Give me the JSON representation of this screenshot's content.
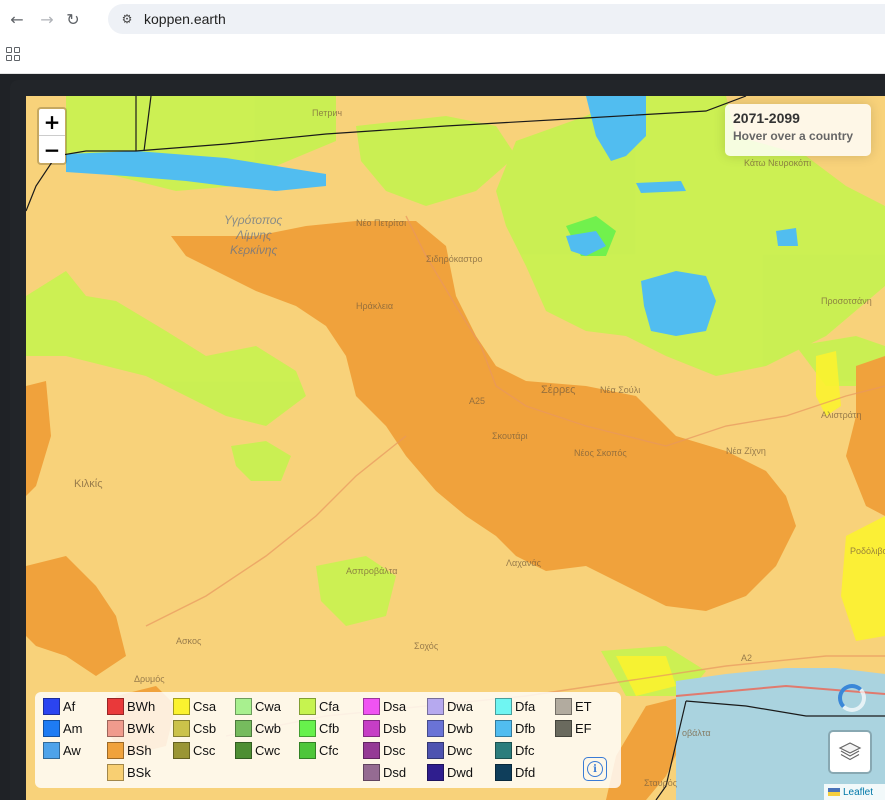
{
  "browser": {
    "url": "koppen.earth",
    "icons": [
      "back-arrow-icon",
      "forward-arrow-icon",
      "reload-icon",
      "site-settings-icon",
      "apps-grid-icon"
    ]
  },
  "map": {
    "zoom_in": "+",
    "zoom_out": "−",
    "info": {
      "period": "2071-2099",
      "hint": "Hover over a country"
    },
    "places": {
      "petrich": "Πетрич",
      "kato_nevrokopi": "Κάτω Νευροκόπι",
      "lake_1": "Υγρότοπος",
      "lake_2": "Λίμνης",
      "lake_3": "Κερκίνης",
      "nea_petritsi": "Νέο Πετρίτσι",
      "sidirokastro": "Σιδηρόκαστρο",
      "irakleia": "Ηράκλεια",
      "serres": "Σέρρες",
      "nea_souli": "Νέα Σούλι",
      "a25": "A25",
      "prosotsani": "Προσοτσάνη",
      "alistrati": "Αλιστράτη",
      "nea_zichni": "Νέα Ζίχνη",
      "skoutari": "Σκουτάρι",
      "neos_skopos": "Νέος Σκοπός",
      "kilkis": "Κιλκίς",
      "rodolivos": "Ροδόλιβος",
      "lachanas": "Λαχανάς",
      "asprovalta_1": "Ασπροβάλτα",
      "asvestochori": "Ασκος",
      "sochos": "Σοχός",
      "drymos": "Δρυμός",
      "a2": "A2",
      "provalta": "οβάλτα",
      "stavros": "Σταυρός"
    },
    "attribution": "Leaflet"
  },
  "legend": [
    {
      "code": "Af",
      "color": "#2b44f0"
    },
    {
      "code": "Am",
      "color": "#1e7cf3"
    },
    {
      "code": "Aw",
      "color": "#4ea3ea"
    },
    {
      "code": "BWh",
      "color": "#e9393a"
    },
    {
      "code": "BWk",
      "color": "#f09b8d"
    },
    {
      "code": "BSh",
      "color": "#f0a23c"
    },
    {
      "code": "BSk",
      "color": "#f8cf72"
    },
    {
      "code": "Csa",
      "color": "#fbf22f"
    },
    {
      "code": "Csb",
      "color": "#cbc24a"
    },
    {
      "code": "Csc",
      "color": "#9a9534"
    },
    {
      "code": "Cwa",
      "color": "#a8f08f"
    },
    {
      "code": "Cwb",
      "color": "#76bb5e"
    },
    {
      "code": "Cwc",
      "color": "#4e8e33"
    },
    {
      "code": "Cfa",
      "color": "#c6f34f"
    },
    {
      "code": "Cfb",
      "color": "#67f14c"
    },
    {
      "code": "Cfc",
      "color": "#4ec63a"
    },
    {
      "code": "Dsa",
      "color": "#f053f2"
    },
    {
      "code": "Dsb",
      "color": "#c63ec5"
    },
    {
      "code": "Dsc",
      "color": "#953a95"
    },
    {
      "code": "Dsd",
      "color": "#956b92"
    },
    {
      "code": "Dwa",
      "color": "#b6a9ef"
    },
    {
      "code": "Dwb",
      "color": "#6a73d6"
    },
    {
      "code": "Dwc",
      "color": "#4e53b0"
    },
    {
      "code": "Dwd",
      "color": "#2f1e8e"
    },
    {
      "code": "Dfa",
      "color": "#6ff5f2"
    },
    {
      "code": "Dfb",
      "color": "#51bdf0"
    },
    {
      "code": "Dfc",
      "color": "#2c7d7c"
    },
    {
      "code": "Dfd",
      "color": "#0f3e5b"
    },
    {
      "code": "ET",
      "color": "#b2ab9f"
    },
    {
      "code": "EF",
      "color": "#6a6a5e"
    }
  ],
  "colors": {
    "BSk_bg": "#f8d27a",
    "BSh": "#f0a23c",
    "Cfa": "#c6f34f",
    "Cfb": "#67f14c",
    "Dfb": "#51bdf0",
    "Csa": "#fbf22f",
    "sea": "#aad3df"
  }
}
